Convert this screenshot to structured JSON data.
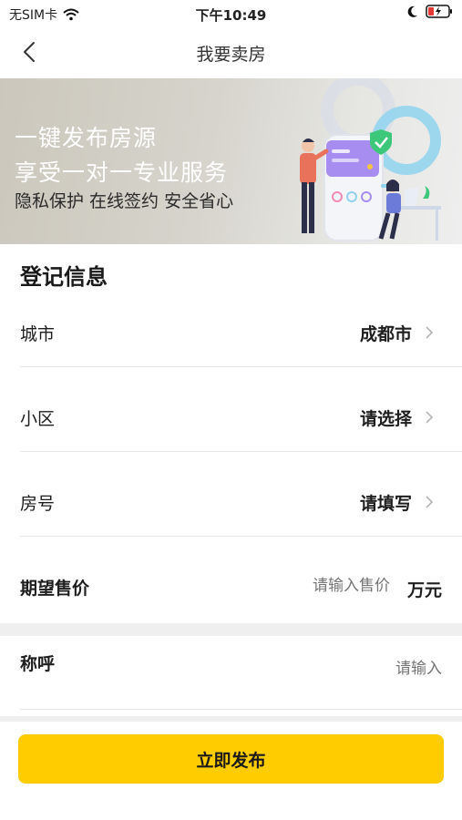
{
  "status_bar": {
    "carrier": "无SIM卡",
    "time": "下午10:49"
  },
  "nav": {
    "title": "我要卖房"
  },
  "banner": {
    "line1": "一键发布房源",
    "line2": "享受一对一专业服务",
    "line3": "隐私保护 在线签约 安全省心"
  },
  "form": {
    "section_title": "登记信息",
    "city": {
      "label": "城市",
      "value": "成都市"
    },
    "community": {
      "label": "小区",
      "value": "请选择"
    },
    "room_number": {
      "label": "房号",
      "value": "请填写"
    },
    "price": {
      "label": "期望售价",
      "placeholder": "请输入售价",
      "unit": "万元"
    },
    "name": {
      "label": "称呼",
      "placeholder": "请输入"
    }
  },
  "submit_label": "立即发布",
  "colors": {
    "accent": "#ffcc00",
    "placeholder": "#b8b8b8",
    "divider": "#e6e6e6"
  }
}
